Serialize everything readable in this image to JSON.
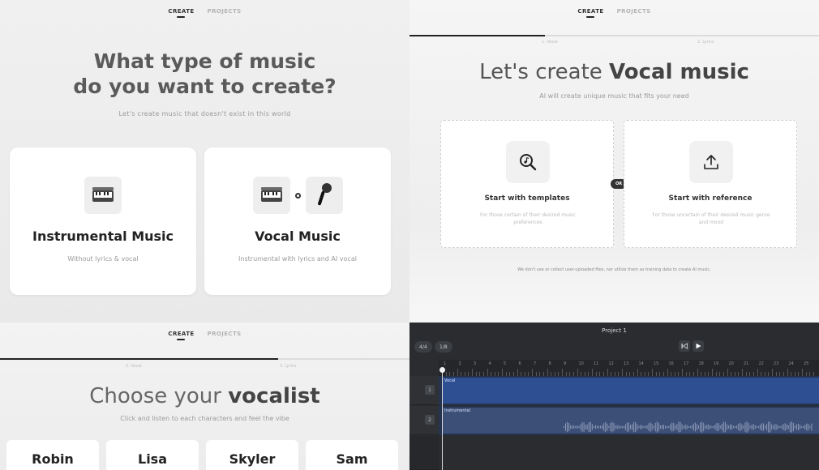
{
  "panel_type": {
    "nav": {
      "create": "CREATE",
      "projects": "PROJECTS"
    },
    "title_line1": "What type of music",
    "title_line2": "do you want to create?",
    "subtitle": "Let's create music that doesn't exist in this world",
    "cards": [
      {
        "title": "Instrumental Music",
        "subtitle": "Without lyrics & vocal",
        "icons": [
          "keyboard-icon"
        ]
      },
      {
        "title": "Vocal Music",
        "subtitle": "Instrumental with lyrics and AI vocal",
        "icons": [
          "keyboard-icon",
          "microphone-icon"
        ]
      }
    ]
  },
  "panel_vocal": {
    "nav": {
      "create": "CREATE",
      "projects": "PROJECTS"
    },
    "steps": [
      "1. Vocal",
      "2. Lyrics"
    ],
    "progress": 0.33,
    "title_prefix": "Let's create",
    "title_bold": "Vocal music",
    "subtitle": "AI will create unique music that fits your need",
    "cards": [
      {
        "title": "Start with templates",
        "subtitle": "For those certain of their desired music preferences",
        "icon": "music-search-icon"
      },
      {
        "title": "Start with reference",
        "subtitle": "For those uncertain of their desired music genre and mood",
        "icon": "upload-icon"
      }
    ],
    "or_label": "OR",
    "note": "We don't use or collect user-uploaded files, nor utilize them as training data to create AI music."
  },
  "panel_vocalist": {
    "nav": {
      "create": "CREATE",
      "projects": "PROJECTS"
    },
    "steps": [
      "2. Vocal",
      "3. Lyrics"
    ],
    "progress": 0.68,
    "title_prefix": "Choose your",
    "title_bold": "vocalist",
    "subtitle": "Click and listen to each characters and feel the vibe",
    "vocalists": [
      "Robin",
      "Lisa",
      "Skyler",
      "Sam"
    ]
  },
  "panel_editor": {
    "project_title": "Project 1",
    "time_signature": "4/4",
    "key_chip": "1/8",
    "ruler_numbers": [
      "1",
      "2",
      "3",
      "4",
      "5",
      "6",
      "7",
      "8",
      "9",
      "10",
      "11",
      "12",
      "13",
      "14",
      "15",
      "16",
      "17",
      "18",
      "19",
      "20",
      "21",
      "22",
      "23",
      "24",
      "25"
    ],
    "tracks": [
      {
        "label": "Vocal",
        "number": "1"
      },
      {
        "label": "Instrumental",
        "number": "2"
      }
    ],
    "colors": {
      "clip": "#2f4f93",
      "lane": "#26334f",
      "background": "#2a2c2f"
    }
  }
}
